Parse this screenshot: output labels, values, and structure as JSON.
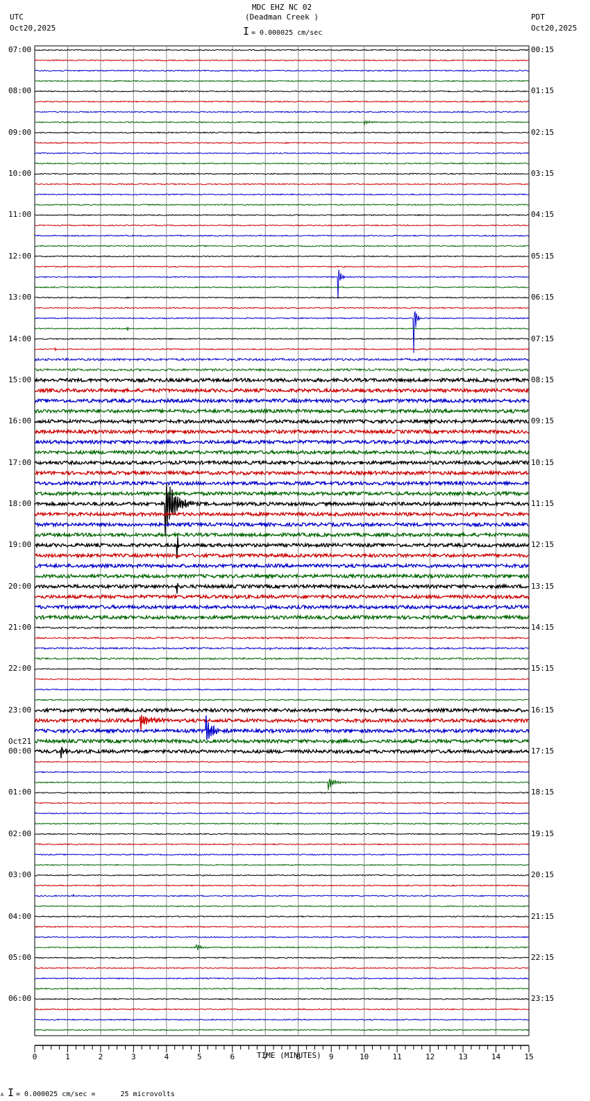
{
  "header": {
    "title": "MDC EHZ NC 02",
    "subtitle": "(Deadman Creek )",
    "left_tz": "UTC",
    "left_date": "Oct20,2025",
    "right_tz": "PDT",
    "right_date": "Oct20,2025",
    "scale": "= 0.000025 cm/sec"
  },
  "footer": {
    "scale": "= 0.000025 cm/sec =      25 microvolts",
    "mark": "A"
  },
  "chart_data": {
    "type": "line",
    "title": "MDC EHZ NC 02 (Deadman Creek )",
    "xlabel": "TIME (MINUTES)",
    "xlim": [
      0,
      15
    ],
    "xticks": [
      "0",
      "1",
      "2",
      "3",
      "4",
      "5",
      "6",
      "7",
      "8",
      "9",
      "10",
      "11",
      "12",
      "13",
      "14",
      "15"
    ],
    "traces_per_hour": 4,
    "trace_colors": [
      "#000000",
      "#cc0000",
      "#0000cc",
      "#006600"
    ],
    "left_labels": [
      "07:00",
      "08:00",
      "09:00",
      "10:00",
      "11:00",
      "12:00",
      "13:00",
      "14:00",
      "15:00",
      "16:00",
      "17:00",
      "18:00",
      "19:00",
      "20:00",
      "21:00",
      "22:00",
      "23:00",
      "00:00",
      "01:00",
      "02:00",
      "03:00",
      "04:00",
      "05:00",
      "06:00"
    ],
    "left_date_change": {
      "hour_index": 17,
      "label": "Oct21"
    },
    "right_labels": [
      "00:15",
      "01:15",
      "02:15",
      "03:15",
      "04:15",
      "05:15",
      "06:15",
      "07:15",
      "08:15",
      "09:15",
      "10:15",
      "11:15",
      "12:15",
      "13:15",
      "14:15",
      "15:15",
      "16:15",
      "17:15",
      "18:15",
      "19:15",
      "20:15",
      "21:15",
      "22:15",
      "23:15"
    ],
    "noise_level_by_trace": [
      {
        "from": 0,
        "to": 29,
        "level": 1
      },
      {
        "from": 30,
        "to": 31,
        "level": 2
      },
      {
        "from": 32,
        "to": 55,
        "level": 3
      },
      {
        "from": 56,
        "to": 59,
        "level": 1.5
      },
      {
        "from": 60,
        "to": 63,
        "level": 1
      },
      {
        "from": 64,
        "to": 68,
        "level": 3
      },
      {
        "from": 69,
        "to": 95,
        "level": 1
      }
    ],
    "events": [
      {
        "trace": 7,
        "minute": 10.0,
        "duration": 0.7,
        "amplitude": 4
      },
      {
        "trace": 22,
        "minute": 9.2,
        "duration": 0.2,
        "amplitude": 35
      },
      {
        "trace": 26,
        "minute": 11.5,
        "duration": 0.2,
        "amplitude": 60
      },
      {
        "trace": 27,
        "minute": 2.8,
        "duration": 0.1,
        "amplitude": 12
      },
      {
        "trace": 29,
        "minute": 0.6,
        "duration": 0.1,
        "amplitude": 6
      },
      {
        "trace": 44,
        "minute": 3.95,
        "duration": 0.9,
        "amplitude": 70
      },
      {
        "trace": 48,
        "minute": 4.3,
        "duration": 0.1,
        "amplitude": 60
      },
      {
        "trace": 52,
        "minute": 4.3,
        "duration": 0.1,
        "amplitude": 30
      },
      {
        "trace": 58,
        "minute": 7.1,
        "duration": 0.3,
        "amplitude": 5
      },
      {
        "trace": 65,
        "minute": 3.2,
        "duration": 0.8,
        "amplitude": 16
      },
      {
        "trace": 66,
        "minute": 5.2,
        "duration": 0.8,
        "amplitude": 24
      },
      {
        "trace": 66,
        "minute": 4.2,
        "duration": 0.4,
        "amplitude": 4
      },
      {
        "trace": 68,
        "minute": 0.8,
        "duration": 0.5,
        "amplitude": 10
      },
      {
        "trace": 71,
        "minute": 8.9,
        "duration": 0.6,
        "amplitude": 15
      },
      {
        "trace": 82,
        "minute": 1.15,
        "duration": 0.1,
        "amplitude": 8
      },
      {
        "trace": 87,
        "minute": 4.9,
        "duration": 0.5,
        "amplitude": 8
      }
    ]
  }
}
